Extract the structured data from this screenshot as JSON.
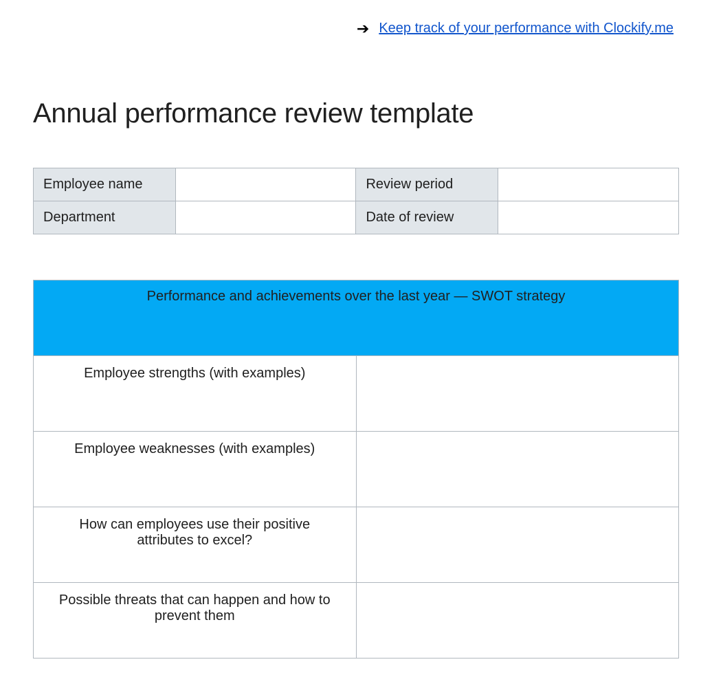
{
  "header": {
    "link_text": "Keep track of your performance with Clockify.me"
  },
  "title": "Annual performance review template",
  "info_table": {
    "rows": [
      {
        "label1": "Employee name",
        "value1": "",
        "label2": "Review period",
        "value2": ""
      },
      {
        "label1": "Department",
        "value1": "",
        "label2": "Date of review",
        "value2": ""
      }
    ]
  },
  "swot": {
    "heading": "Performance and achievements over the last year — SWOT strategy",
    "rows": [
      {
        "label": "Employee strengths (with examples)",
        "value": ""
      },
      {
        "label": "Employee weaknesses (with examples)",
        "value": ""
      },
      {
        "label": "How can employees use their positive attributes to excel?",
        "value": ""
      },
      {
        "label": "Possible threats that can happen and how to prevent them",
        "value": ""
      }
    ]
  }
}
